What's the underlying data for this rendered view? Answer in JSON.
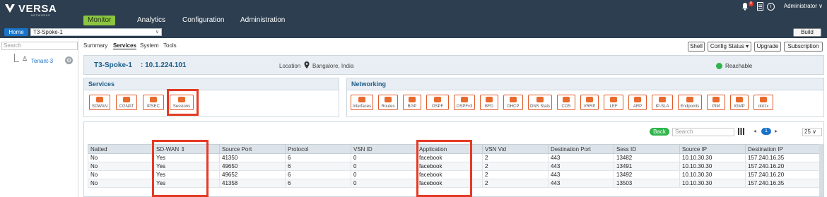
{
  "brand": {
    "name": "VERSA",
    "sub": "NETWORKS"
  },
  "nav": {
    "items": [
      "Monitor",
      "Analytics",
      "Configuration",
      "Administration"
    ],
    "active": "Monitor"
  },
  "header_right": {
    "notifications": "0",
    "user": "Administrator ∨"
  },
  "subbar": {
    "home": "Home",
    "device": "T3-Spoke-1",
    "build": "Build"
  },
  "tree": {
    "search_placeholder": "Search",
    "tenant": "Tenant-3"
  },
  "tabs": [
    "Summary",
    "Services",
    "System",
    "Tools"
  ],
  "actions": {
    "shell": "Shell",
    "config_status": "Config Status ▾",
    "upgrade": "Upgrade",
    "subscription": "Subscription"
  },
  "device_info": {
    "name": "T3-Spoke-1",
    "ip": ": 10.1.224.101",
    "location_label": "Location",
    "location": "Bangalore, India",
    "status": "Reachable",
    "status_color": "#2fb54b"
  },
  "services": {
    "title": "Services",
    "items": [
      "SDWAN",
      "CGNAT",
      "IPSEC",
      "Sessions"
    ],
    "selected": "Sessions"
  },
  "networking": {
    "title": "Networking",
    "items": [
      "Interfaces",
      "Routes",
      "BGP",
      "OSPF",
      "OSPFv3",
      "BFD",
      "DHCP",
      "DNS Stats",
      "COS",
      "VRRP",
      "LEF",
      "ARP",
      "IP-SLA",
      "Endpoints",
      "PIM",
      "IGMP",
      "dot1x"
    ]
  },
  "table": {
    "back": "Back",
    "search_placeholder": "Search",
    "page": "1",
    "per_page": "25 ∨",
    "columns": [
      "Natted",
      "SD-WAN ⇕",
      "Source Port",
      "Protocol",
      "VSN ID",
      "Application",
      "VSN Vid",
      "Destination Port",
      "Sess ID",
      "Source IP",
      "Destination IP"
    ],
    "rows": [
      [
        "No",
        "Yes",
        "41350",
        "6",
        "0",
        "facebook",
        "2",
        "443",
        "13482",
        "10.10.30.30",
        "157.240.16.35"
      ],
      [
        "No",
        "Yes",
        "49650",
        "6",
        "0",
        "facebook",
        "2",
        "443",
        "13491",
        "10.10.30.30",
        "157.240.16.20"
      ],
      [
        "No",
        "Yes",
        "49652",
        "6",
        "0",
        "facebook",
        "2",
        "443",
        "13492",
        "10.10.30.30",
        "157.240.16.20"
      ],
      [
        "No",
        "Yes",
        "41358",
        "6",
        "0",
        "facebook",
        "2",
        "443",
        "13503",
        "10.10.30.30",
        "157.240.16.35"
      ]
    ]
  },
  "colors": {
    "topbar": "#2d3e50",
    "accent_green": "#8cc63f",
    "highlight": "#e53a25",
    "service_icon": "#e86a2e",
    "link_blue": "#1a73c8"
  }
}
